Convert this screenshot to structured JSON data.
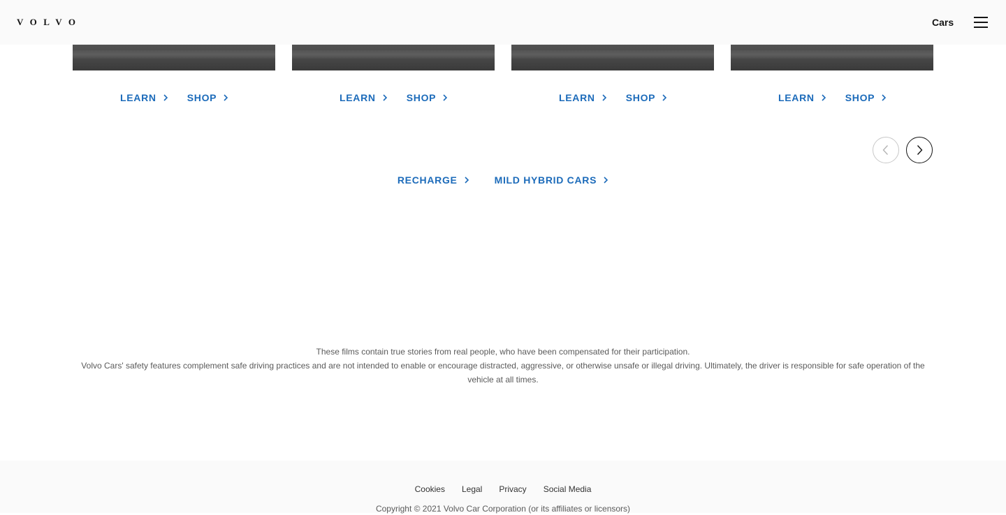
{
  "header": {
    "logo_text": "VOLVO",
    "nav_cars_label": "Cars",
    "menu_icon": "hamburger-menu-icon"
  },
  "cards": [
    {
      "learn_label": "LEARN",
      "shop_label": "SHOP"
    },
    {
      "learn_label": "LEARN",
      "shop_label": "SHOP"
    },
    {
      "learn_label": "LEARN",
      "shop_label": "SHOP"
    },
    {
      "learn_label": "LEARN",
      "shop_label": "SHOP"
    }
  ],
  "carousel": {
    "prev_icon": "chevron-left-icon",
    "next_icon": "chevron-right-icon"
  },
  "categories": {
    "recharge_label": "RECHARGE",
    "mild_hybrid_label": "MILD HYBRID CARS"
  },
  "disclaimer": {
    "line1": "These films contain true stories from real people, who have been compensated for their participation.",
    "line2": "Volvo Cars' safety features complement safe driving practices and are not intended to enable or encourage distracted, aggressive, or otherwise unsafe or illegal driving. Ultimately, the driver is responsible for safe operation of the vehicle at all times."
  },
  "footer": {
    "links": [
      "Cookies",
      "Legal",
      "Privacy",
      "Social Media"
    ],
    "copyright": "Copyright © 2021 Volvo Car Corporation (or its affiliates or licensors)"
  },
  "colors": {
    "link_blue": "#1c6bba",
    "header_bg": "#fafafa",
    "text_dark": "#141414"
  }
}
